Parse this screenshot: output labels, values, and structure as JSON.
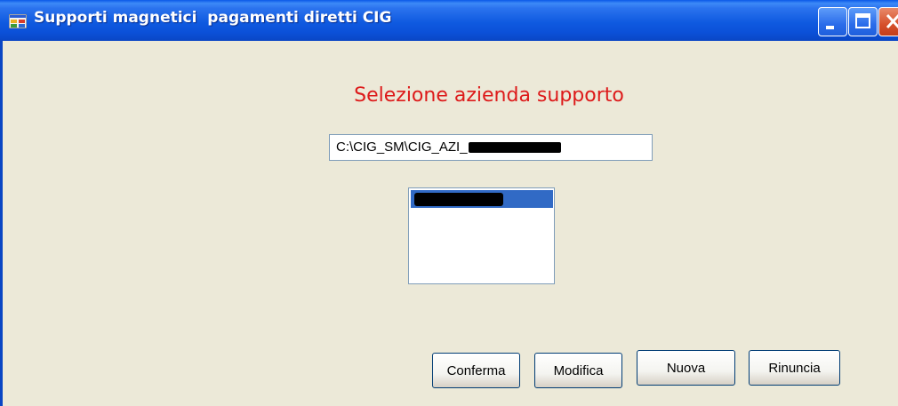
{
  "window": {
    "title": "Supporti magnetici  pagamenti diretti CIG",
    "title_bar_color": "#0a58e8"
  },
  "icons": {
    "app": "app-window-icon",
    "minimize": "minimize-icon",
    "maximize": "maximize-icon",
    "close": "close-icon"
  },
  "main": {
    "heading": "Selezione azienda supporto",
    "heading_color": "#dd1a1a",
    "path_value": "C:\\CIG_SM\\CIG_AZI_",
    "path_redacted": true,
    "list": {
      "items": [
        {
          "label": "",
          "selected": true,
          "redacted": true
        }
      ]
    }
  },
  "buttons": {
    "conferma": "Conferma",
    "modifica": "Modifica",
    "nuova": "Nuova",
    "rinuncia": "Rinuncia"
  }
}
